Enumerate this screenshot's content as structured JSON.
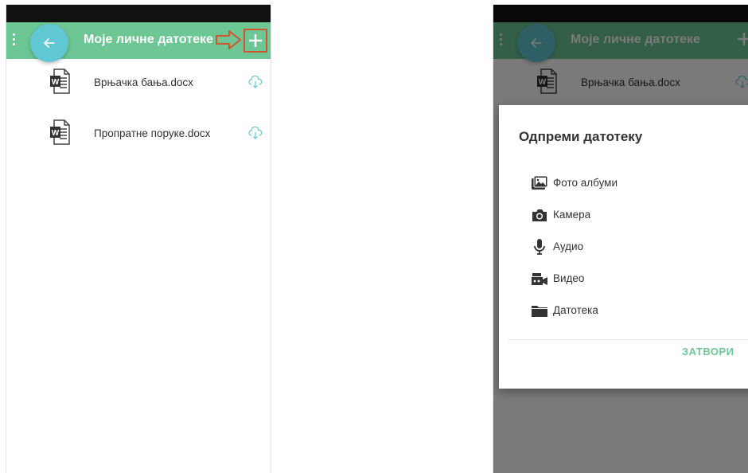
{
  "app": {
    "title": "Моје личне датотеке"
  },
  "files": [
    {
      "name": "Врњачка бања.docx"
    },
    {
      "name": "Пропратне поруке.docx"
    }
  ],
  "upload_dialog": {
    "title": "Одпреми датотеку",
    "options": [
      {
        "label": "Фото албуми",
        "icon": "photo-album-icon"
      },
      {
        "label": "Камера",
        "icon": "camera-icon"
      },
      {
        "label": "Аудио",
        "icon": "microphone-icon"
      },
      {
        "label": "Видео",
        "icon": "video-camera-icon"
      },
      {
        "label": "Датотека",
        "icon": "folder-icon"
      }
    ],
    "close_label": "ЗАТВОРИ"
  },
  "colors": {
    "app_bar": "#6cc794",
    "fab": "#61c7d2",
    "highlight": "#d2552f",
    "accent_text": "#6cc794"
  }
}
